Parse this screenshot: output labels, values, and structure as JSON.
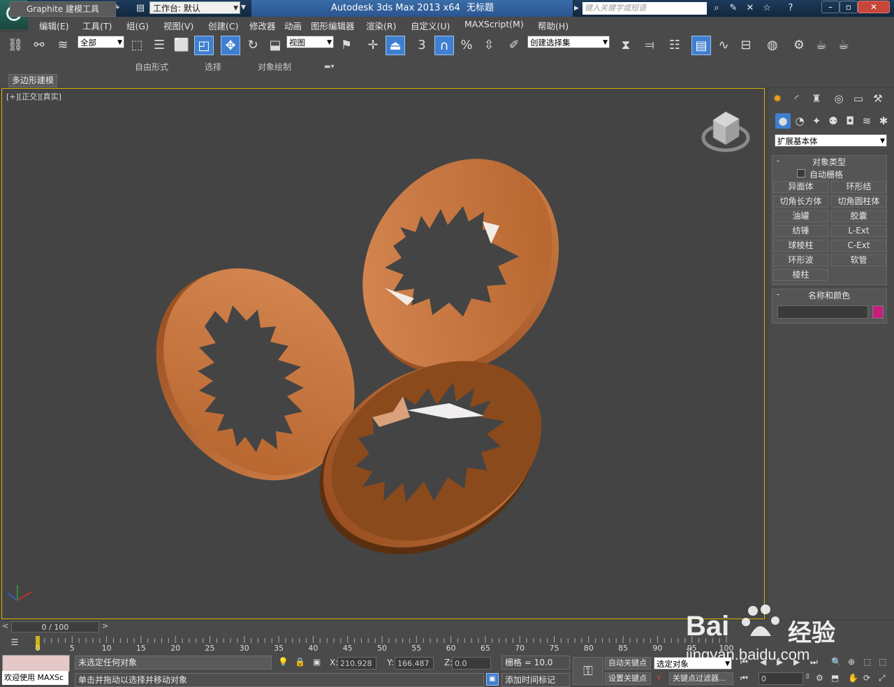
{
  "titlebar": {
    "workspace_label": "工作台: 默认",
    "app_title": "Autodesk 3ds Max  2013 x64",
    "doc_title": "无标题",
    "search_placeholder": "键入关键字或短语"
  },
  "menu": [
    "编辑(E)",
    "工具(T)",
    "组(G)",
    "视图(V)",
    "创建(C)",
    "修改器",
    "动画",
    "图形编辑器",
    "渲染(R)",
    "自定义(U)",
    "MAXScript(M)",
    "帮助(H)"
  ],
  "toolbar": {
    "selection_filter": "全部",
    "ref_coord": "视图",
    "named_selection": "创建选择集",
    "snap_3": "3",
    "snap_pct": "%"
  },
  "ribbon": {
    "tabs": [
      "Graphite 建模工具",
      "自由形式",
      "选择",
      "对象绘制"
    ],
    "sub_label": "多边形建模"
  },
  "viewport": {
    "label": "[+][正交][真实]",
    "object_color": "#b5622a"
  },
  "command_panel": {
    "category": "扩展基本体",
    "object_type_title": "对象类型",
    "autogrid_label": "自动栅格",
    "buttons": [
      "异面体",
      "环形结",
      "切角长方体",
      "切角圆柱体",
      "油罐",
      "胶囊",
      "纺锤",
      "L-Ext",
      "球棱柱",
      "C-Ext",
      "环形波",
      "软管",
      "棱柱"
    ],
    "name_color_title": "名称和颜色",
    "swatch_color": "#c81e82"
  },
  "timeline": {
    "frame_display": "0 / 100",
    "ticks": [
      "0",
      "5",
      "10",
      "15",
      "20",
      "25",
      "30",
      "35",
      "40",
      "45",
      "50",
      "55",
      "60",
      "65",
      "70",
      "75",
      "80",
      "85",
      "90",
      "95",
      "100"
    ]
  },
  "status": {
    "welcome": "欢迎使用 MAXSc",
    "selection": "未选定任何对象",
    "prompt": "单击并拖动以选择并移动对象",
    "x_label": "X:",
    "x_value": "210.928",
    "y_label": "Y:",
    "y_value": "166.487",
    "z_label": "Z:",
    "z_value": "0.0",
    "grid": "栅格 = 10.0",
    "add_time_tag": "添加时间标记",
    "auto_key": "自动关键点",
    "set_key": "设置关键点",
    "selected_dropdown": "选定对象",
    "key_filters": "关键点过滤器...",
    "frame_field": "0"
  },
  "watermark": {
    "brand": "Bai",
    "brand_cn": "经验",
    "url": "jingyan.baidu.com"
  }
}
